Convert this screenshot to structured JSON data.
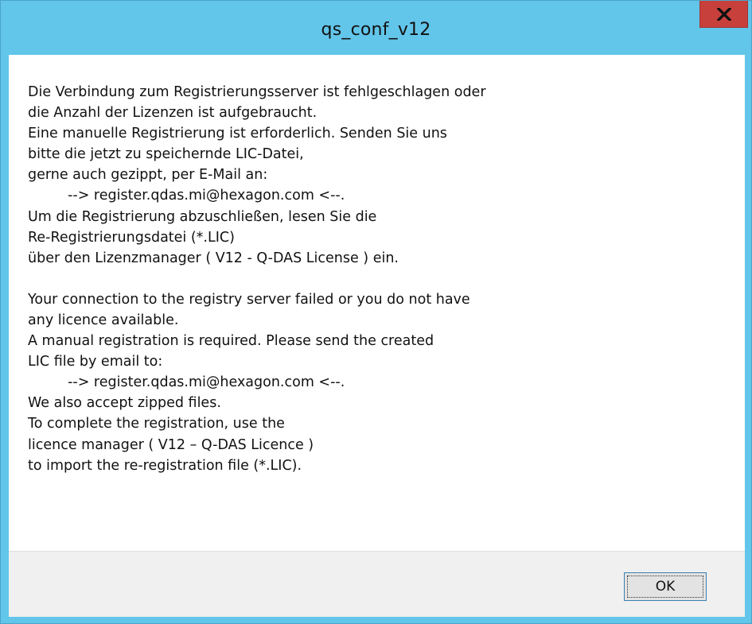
{
  "window": {
    "title": "qs_conf_v12"
  },
  "icons": {
    "close": "close-icon"
  },
  "colors": {
    "titlebar": "#62c5ea",
    "close_button": "#c7403c",
    "footer": "#f0f0f0"
  },
  "message": {
    "german": [
      "Die Verbindung zum Registrierungsserver ist fehlgeschlagen oder",
      "die Anzahl der Lizenzen ist aufgebraucht.",
      "Eine manuelle Registrierung ist erforderlich. Senden Sie uns",
      "bitte die jetzt zu speichernde LIC-Datei,",
      "gerne auch gezippt, per E-Mail an:",
      "         --> register.qdas.mi@hexagon.com <--.",
      "Um die Registrierung abzuschließen, lesen Sie die",
      "Re-Registrierungsdatei (*.LIC)",
      "über den Lizenzmanager ( V12 - Q-DAS License ) ein."
    ],
    "english": [
      "Your connection to the registry server failed or you do not have",
      "any licence available.",
      "A manual registration is required. Please send the created",
      "LIC file by email to:",
      "         --> register.qdas.mi@hexagon.com <--.",
      "We also accept zipped files.",
      "To complete the registration, use the",
      "licence manager ( V12 – Q-DAS Licence )",
      "to import the re-registration file (*.LIC)."
    ]
  },
  "buttons": {
    "ok_label": "OK"
  }
}
